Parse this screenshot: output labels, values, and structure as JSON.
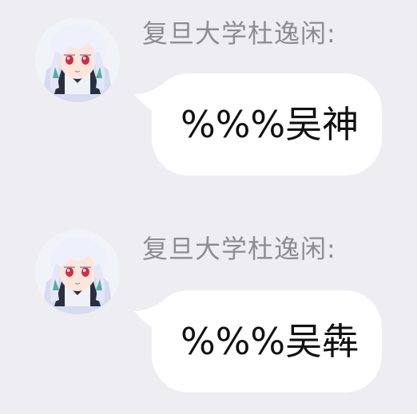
{
  "chat": {
    "messages": [
      {
        "sender": "复旦大学杜逸闲:",
        "avatar": "anime-girl-avatar",
        "text": "%%%吴神"
      },
      {
        "sender": "复旦大学杜逸闲:",
        "avatar": "anime-girl-avatar",
        "text": "%%%吴犇"
      }
    ]
  },
  "colors": {
    "background": "#ededf2",
    "bubble": "#ffffff",
    "sender_text": "#8d8d91",
    "message_text": "#111111"
  }
}
